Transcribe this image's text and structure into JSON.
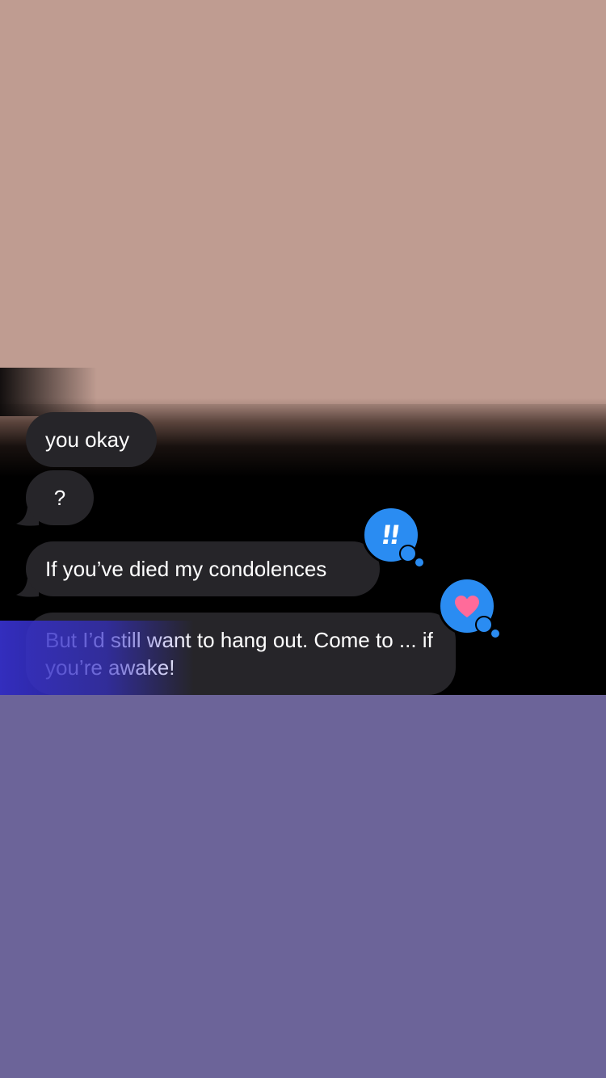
{
  "messages": [
    {
      "text": "you okay"
    },
    {
      "text": "?"
    },
    {
      "text": "If you’ve died my condolences",
      "tapback": "exclamation-icon"
    },
    {
      "text": "But I’d still want to hang out. Come to ... if you’re awake!",
      "tapback": "heart-icon"
    }
  ],
  "colors": {
    "bubble": "#262529",
    "tapback": "#2a8cf2",
    "heart": "#ff6b9a",
    "top_background": "#bf9c91",
    "bottom_background": "#6c6499"
  }
}
